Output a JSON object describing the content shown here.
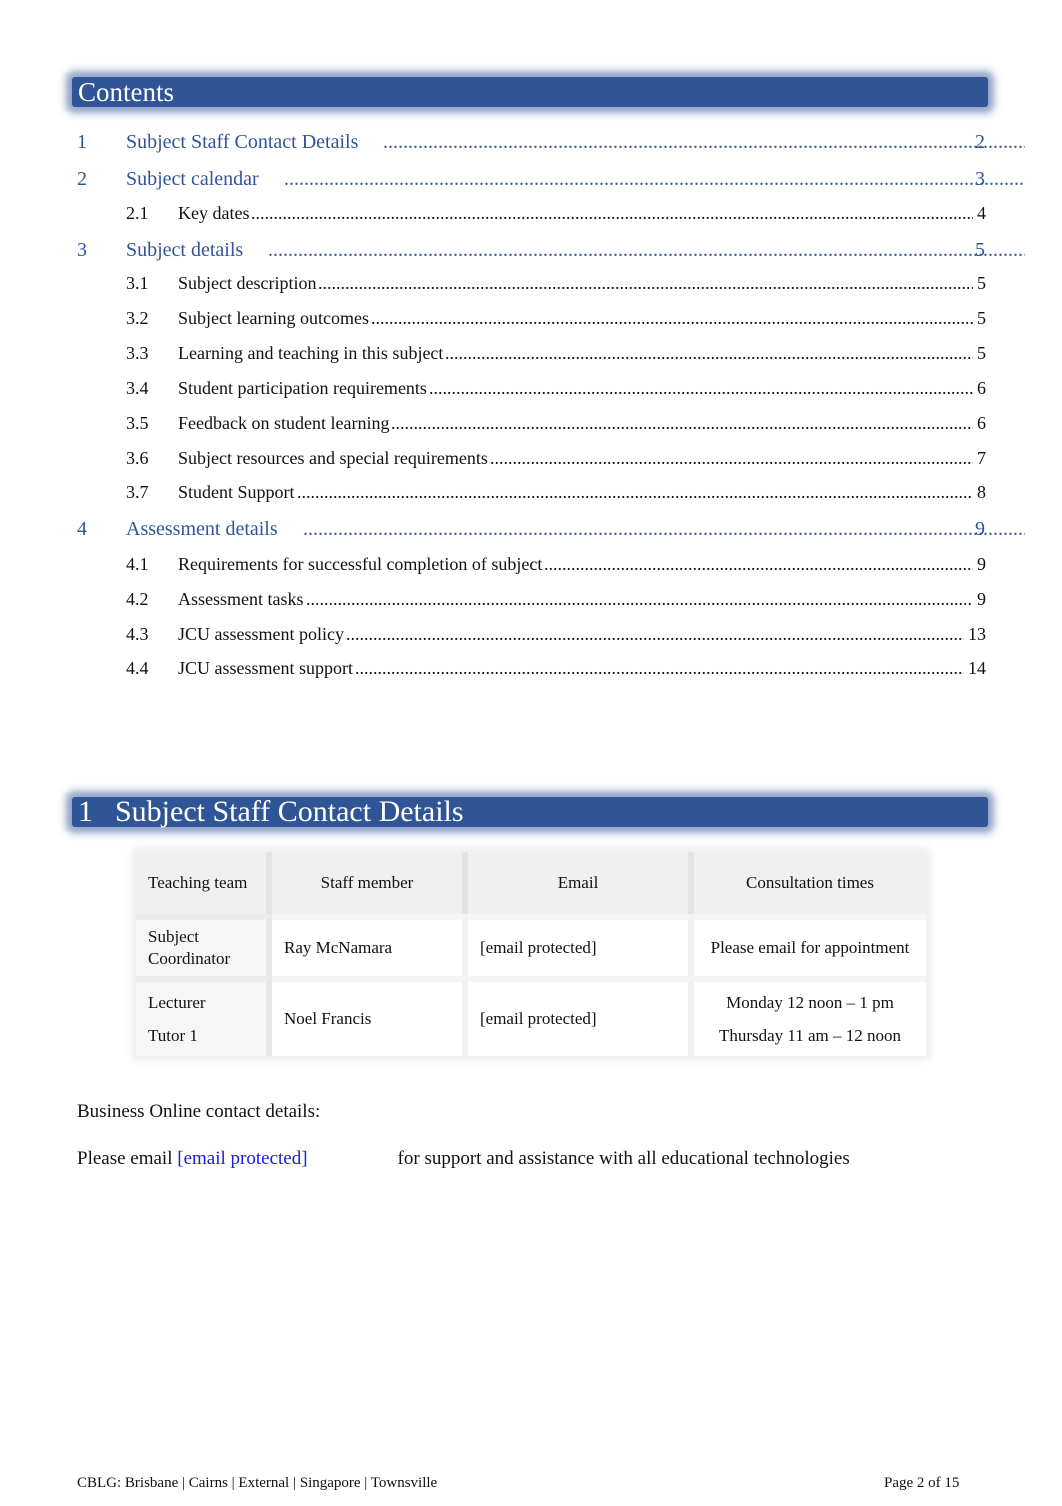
{
  "contents": {
    "title": "Contents",
    "entries": [
      {
        "num": "1",
        "title": "Subject Staff Contact Details",
        "page": "2",
        "level": 1
      },
      {
        "num": "2",
        "title": "Subject calendar",
        "page": "3",
        "level": 1
      },
      {
        "num": "2.1",
        "title": "Key dates",
        "page": "4",
        "level": 2
      },
      {
        "num": "3",
        "title": "Subject details",
        "page": "5",
        "level": 1
      },
      {
        "num": "3.1",
        "title": "Subject description",
        "page": "5",
        "level": 2
      },
      {
        "num": "3.2",
        "title": "Subject learning outcomes",
        "page": "5",
        "level": 2
      },
      {
        "num": "3.3",
        "title": "Learning and teaching in this subject",
        "page": "5",
        "level": 2
      },
      {
        "num": "3.4",
        "title": "Student participation requirements",
        "page": "6",
        "level": 2
      },
      {
        "num": "3.5",
        "title": "Feedback on student learning",
        "page": "6",
        "level": 2
      },
      {
        "num": "3.6",
        "title": "Subject resources and special requirements",
        "page": "7",
        "level": 2
      },
      {
        "num": "3.7",
        "title": "Student Support",
        "page": "8",
        "level": 2
      },
      {
        "num": "4",
        "title": "Assessment details",
        "page": "9",
        "level": 1
      },
      {
        "num": "4.1",
        "title": "Requirements for successful completion of subject",
        "page": "9",
        "level": 2
      },
      {
        "num": "4.2",
        "title": "Assessment tasks",
        "page": "9",
        "level": 2
      },
      {
        "num": "4.3",
        "title": "JCU assessment policy",
        "page": "13",
        "level": 2
      },
      {
        "num": "4.4",
        "title": "JCU assessment support",
        "page": "14",
        "level": 2
      }
    ]
  },
  "section1": {
    "num": "1",
    "title": "Subject Staff Contact Details",
    "table": {
      "headers": [
        "Teaching team",
        "Staff member",
        "Email",
        "Consultation times"
      ],
      "rows": [
        {
          "role": "Subject Coordinator",
          "staff": "Ray McNamara",
          "email": "[email protected]",
          "consultation": [
            "Please email for appointment"
          ]
        },
        {
          "role": "Lecturer",
          "role2": "Tutor 1",
          "staff": "Noel Francis",
          "email": "[email protected]",
          "consultation": [
            "Monday 12 noon – 1 pm",
            "Thursday 11 am – 12 noon"
          ]
        }
      ]
    },
    "business_online_heading": "Business Online contact details:",
    "support_prefix": "Please email ",
    "support_email": "[email protected]",
    "support_suffix": "for support and assistance with all educational technologies"
  },
  "footer": {
    "left": "CBLG: Brisbane | Cairns | External | Singapore | Townsville",
    "right": "Page 2 of 15"
  },
  "colors": {
    "heading_bar": "#2f5597",
    "toc_level1": "#2f5597",
    "link": "#1a1adc"
  }
}
